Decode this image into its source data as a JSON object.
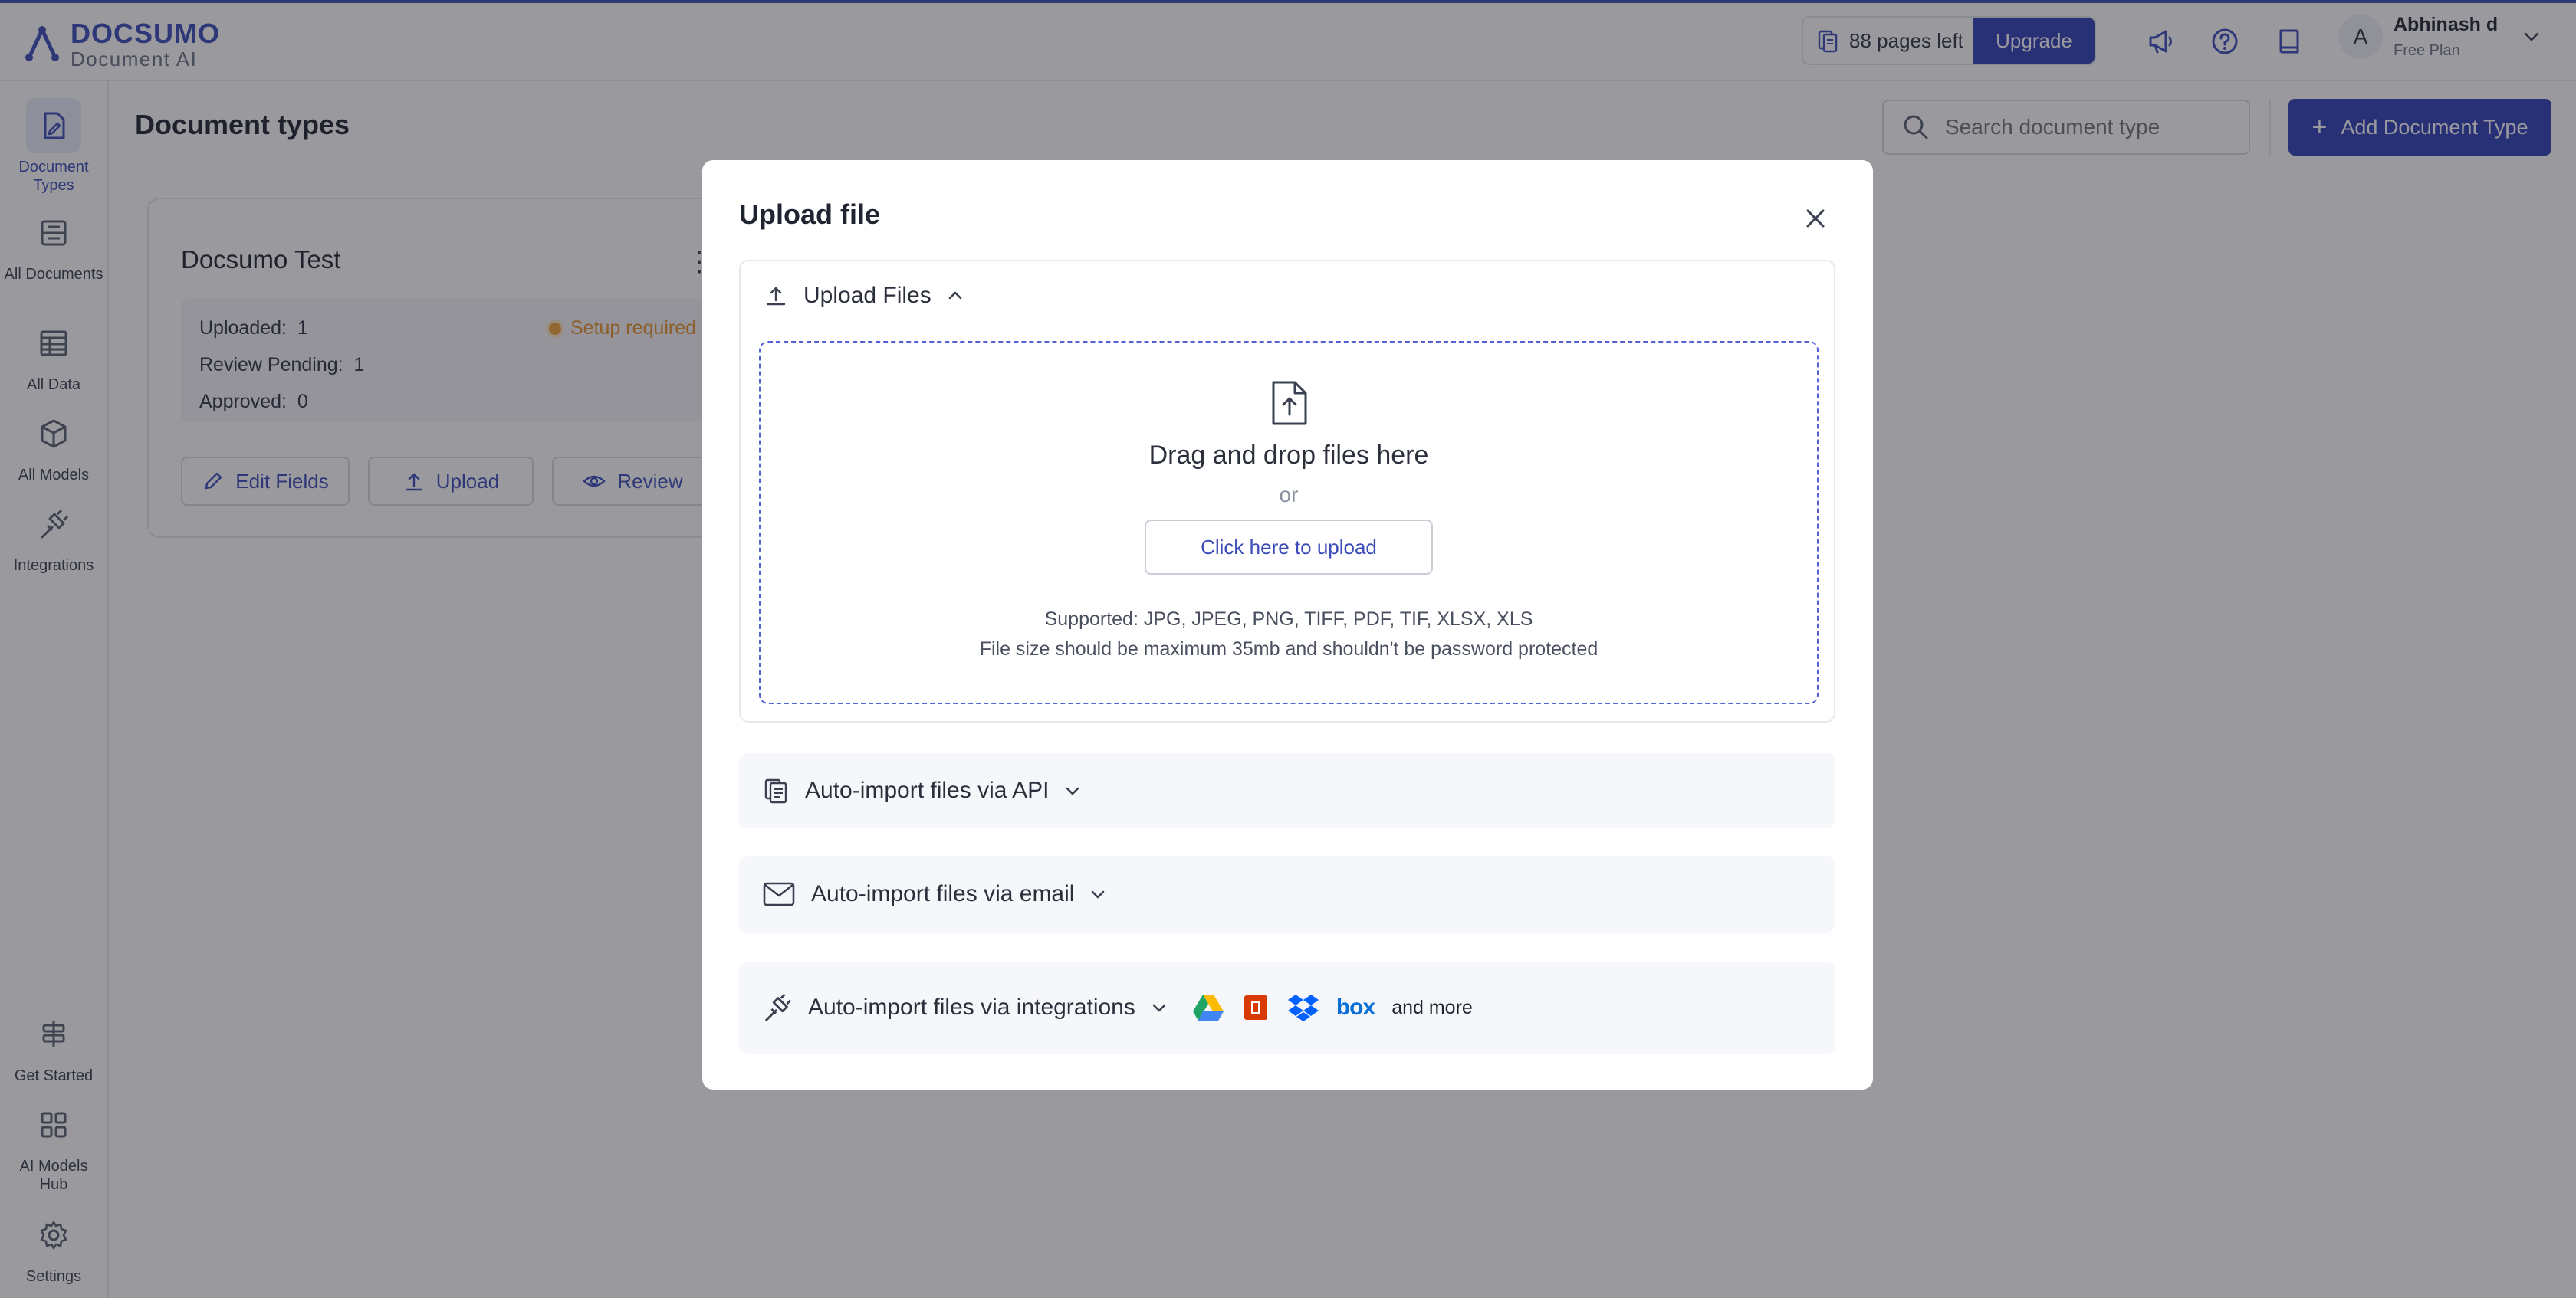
{
  "brand": {
    "name": "DOCSUMO",
    "sub": "Document AI"
  },
  "topbar": {
    "pages_left": "88 pages left",
    "upgrade": "Upgrade",
    "user_initial": "A",
    "user_name": "Abhinash d",
    "user_plan": "Free Plan"
  },
  "sidebar": {
    "items": [
      {
        "label": "Document Types",
        "icon": "document-types-icon"
      },
      {
        "label": "All Documents",
        "icon": "all-documents-icon"
      },
      {
        "label": "All Data",
        "icon": "table-icon"
      },
      {
        "label": "All Models",
        "icon": "cube-icon"
      },
      {
        "label": "Integrations",
        "icon": "plug-icon"
      }
    ],
    "bottom": [
      {
        "label": "Get Started",
        "icon": "signpost-icon"
      },
      {
        "label": "AI Models Hub",
        "icon": "grid-icon"
      },
      {
        "label": "Settings",
        "icon": "gear-icon"
      }
    ]
  },
  "main": {
    "title": "Document types",
    "search_placeholder": "Search document type",
    "add_button": "Add Document Type",
    "card": {
      "title": "Docsumo Test",
      "uploaded_label": "Uploaded:",
      "uploaded": "1",
      "review_label": "Review Pending:",
      "review": "1",
      "approved_label": "Approved:",
      "approved": "0",
      "status": "Setup required",
      "edit": "Edit Fields",
      "upload": "Upload",
      "review_btn": "Review"
    }
  },
  "modal": {
    "title": "Upload file",
    "upload_section": "Upload Files",
    "drag_text": "Drag and drop files here",
    "or": "or",
    "click_upload": "Click here to upload",
    "supported": "Supported: JPG, JPEG, PNG, TIFF, PDF, TIF, XLSX, XLS",
    "limit": "File size should be maximum 35mb and shouldn't be password protected",
    "api": "Auto-import files via API",
    "email": "Auto-import files via email",
    "integrations": "Auto-import files via integrations",
    "box_logo": "box",
    "and_more": "and more"
  }
}
